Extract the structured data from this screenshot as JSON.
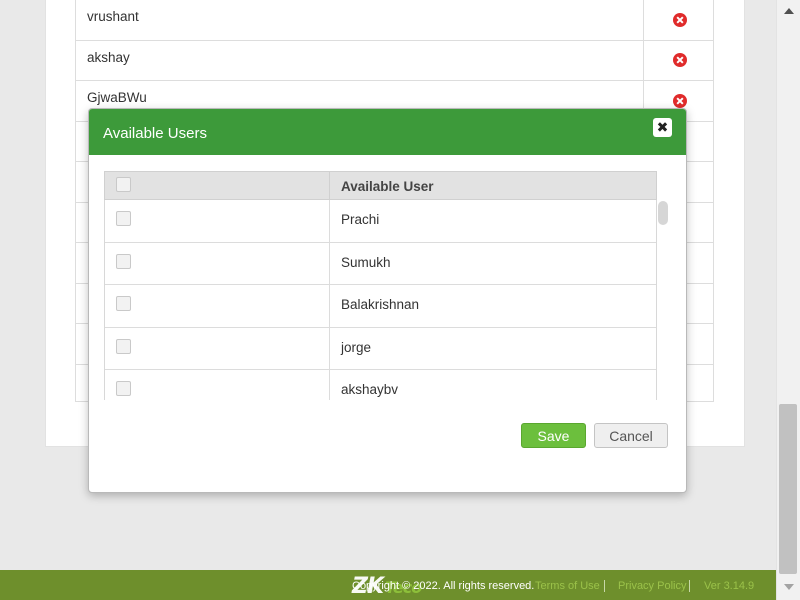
{
  "background_table": {
    "rows": [
      {
        "name": "vrushant"
      },
      {
        "name": "akshay"
      },
      {
        "name": "GjwaBWu"
      },
      {
        "name": ""
      },
      {
        "name": ""
      },
      {
        "name": ""
      },
      {
        "name": ""
      },
      {
        "name": ""
      },
      {
        "name": ""
      },
      {
        "name": ""
      }
    ],
    "delete_icon": "remove-circle-icon",
    "delete_icon_color": "#e02b2b"
  },
  "modal": {
    "title": "Available Users",
    "close_glyph": "✖",
    "header_color": "#3d9a3a",
    "column_header": "Available User",
    "users": [
      {
        "name": "Prachi",
        "checked": false
      },
      {
        "name": "Sumukh",
        "checked": false
      },
      {
        "name": "Balakrishnan",
        "checked": false
      },
      {
        "name": "jorge",
        "checked": false
      },
      {
        "name": "akshaybv",
        "checked": false
      }
    ],
    "save_label": "Save",
    "cancel_label": "Cancel",
    "save_color": "#6cbf3d"
  },
  "footer": {
    "logo_text": "ZK",
    "logo_sub": "Teco",
    "copyright": "Copyright © 2022. All rights reserved.",
    "terms": "Terms of Use",
    "privacy": "Privacy Policy",
    "version": "Ver 3.14.9",
    "bg_color": "#6e8f2c"
  }
}
